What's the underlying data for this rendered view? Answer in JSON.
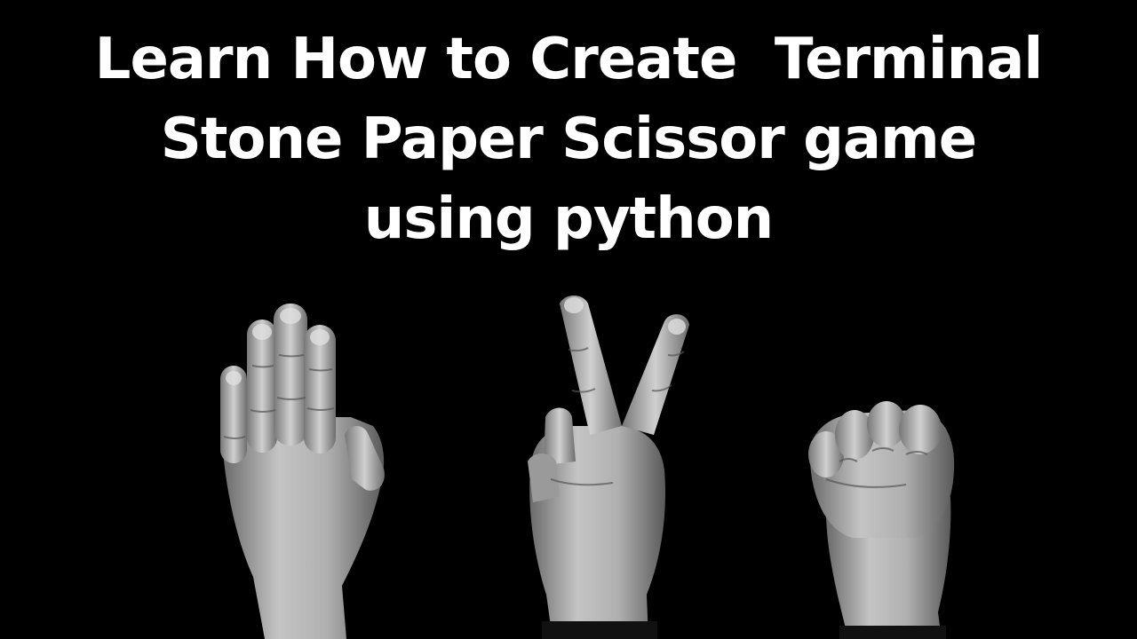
{
  "title": {
    "lines": [
      "Learn How to Create  Terminal",
      "Stone Paper Scissor game",
      "using python"
    ]
  },
  "hands": [
    {
      "name": "paper-hand",
      "gesture": "paper"
    },
    {
      "name": "scissor-hand",
      "gesture": "scissor"
    },
    {
      "name": "stone-hand",
      "gesture": "stone"
    }
  ],
  "colors": {
    "background": "#000000",
    "text": "#ffffff",
    "skin_light": "#c8c8c8",
    "skin_mid": "#9a9a9a",
    "skin_dark": "#5e5e5e"
  }
}
